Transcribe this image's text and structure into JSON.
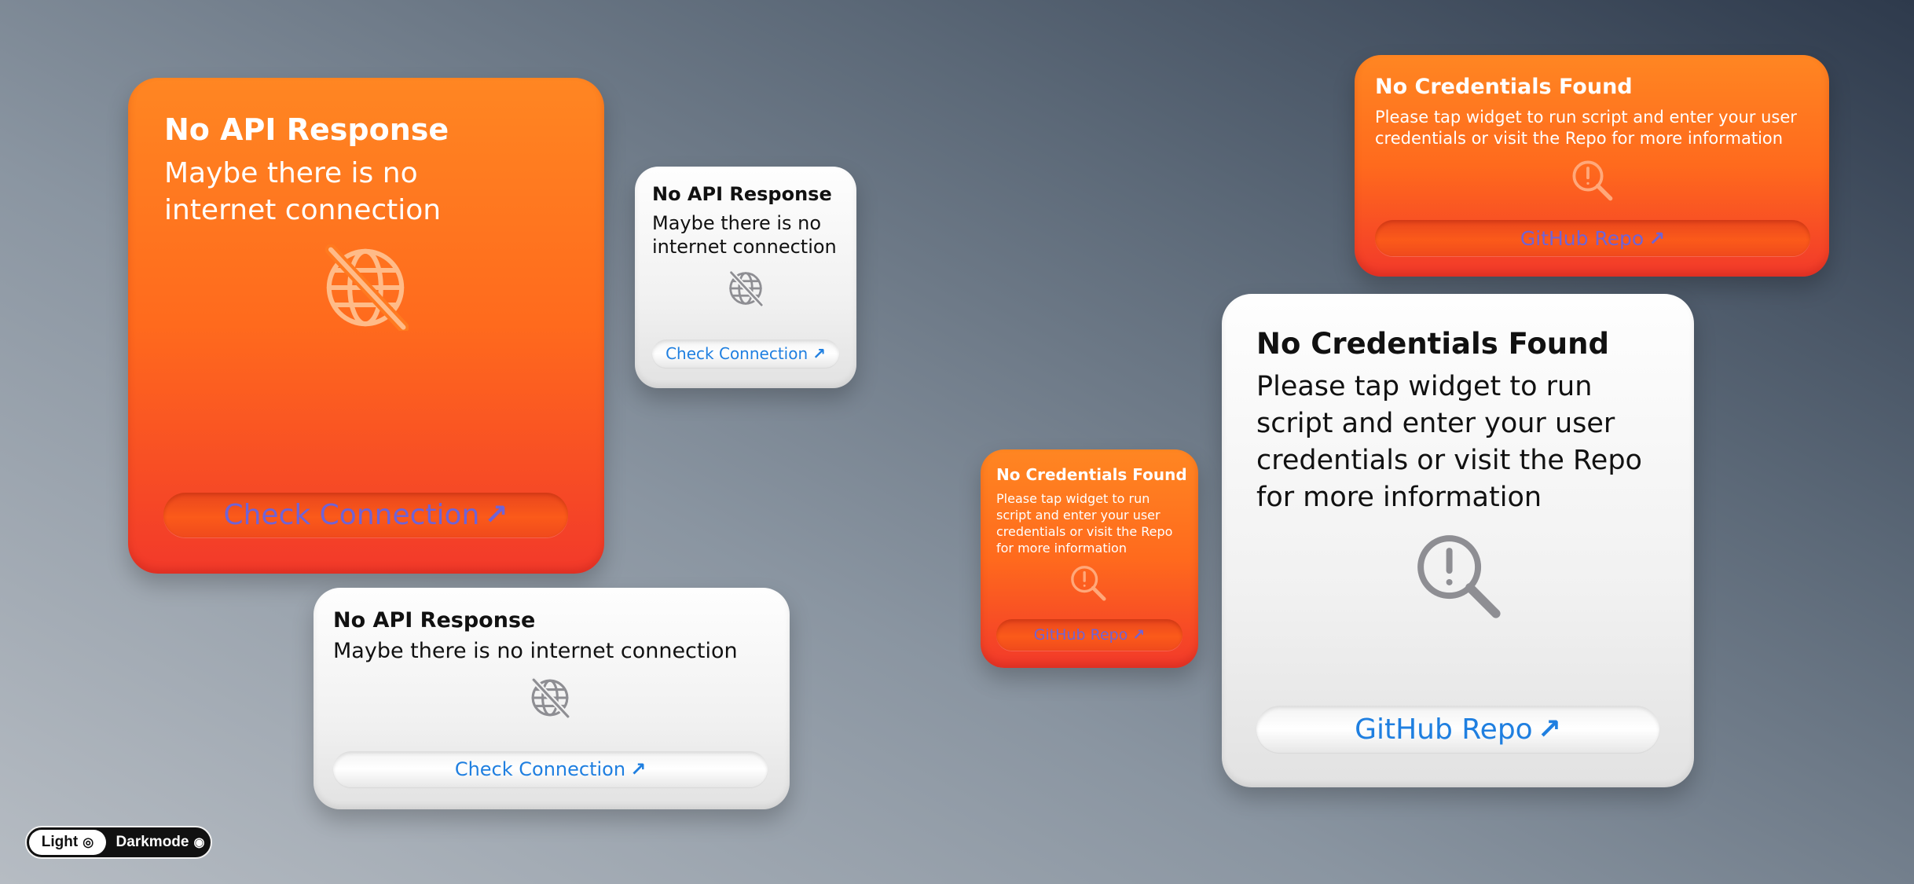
{
  "no_api": {
    "title": "No API Response",
    "message": "Maybe there is no internet connection",
    "message_line1": "Maybe there is no",
    "message_line2": "internet connection",
    "button": "Check Connection",
    "icon": "globe-slash-icon"
  },
  "no_creds": {
    "title": "No Credentials Found",
    "message": "Please tap widget to run script and enter your user credentials or visit the Repo for more information",
    "button": "GitHub Repo",
    "icon": "exclamation-magnifier-icon"
  },
  "button_arrow": "↗",
  "theme_toggle": {
    "light_label": "Light",
    "dark_label": "Darkmode",
    "selected": "Light"
  },
  "colors": {
    "orange_top": "#ff8622",
    "orange_bottom": "#f2392a",
    "link_blue": "#1f7fe0",
    "link_on_orange": "#6f63d6",
    "icon_gray": "#8e8e93"
  }
}
